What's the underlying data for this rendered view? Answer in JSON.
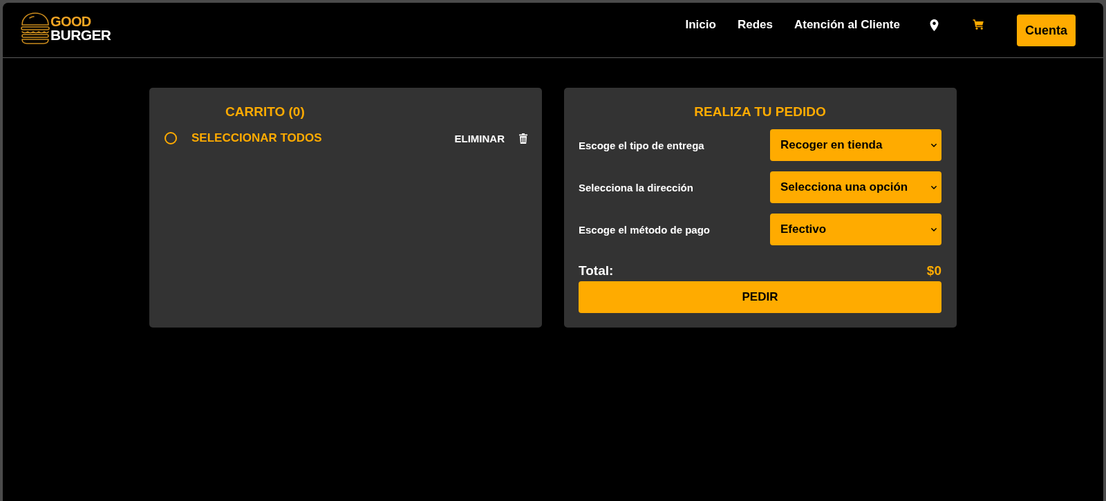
{
  "header": {
    "logo": {
      "top": "GOOD",
      "bottom": "BURGER"
    },
    "nav": [
      {
        "label": "Inicio",
        "selected": false
      },
      {
        "label": "Redes",
        "selected": false
      },
      {
        "label": "Atención al Cliente",
        "selected": false
      }
    ],
    "shortcuts": [
      {
        "kind": "location",
        "selected": false
      },
      {
        "kind": "cart",
        "selected": true
      }
    ],
    "account_button": "Cuenta"
  },
  "cart": {
    "title": "CARRITO (0)",
    "select_all": {
      "label": "SELECCIONAR TODOS",
      "checked": false
    },
    "delete_label": "ELIMINAR"
  },
  "order": {
    "title": "REALIZA TU PEDIDO",
    "fields": [
      {
        "label": "Escoge el tipo de entrega",
        "value": "Recoger en tienda"
      },
      {
        "label": "Selecciona la dirección",
        "value": "Selecciona una opción"
      },
      {
        "label": "Escoge el método de pago",
        "value": "Efectivo"
      }
    ],
    "total": {
      "label": "Total:",
      "value": "$0"
    },
    "submit": "PEDIR"
  }
}
